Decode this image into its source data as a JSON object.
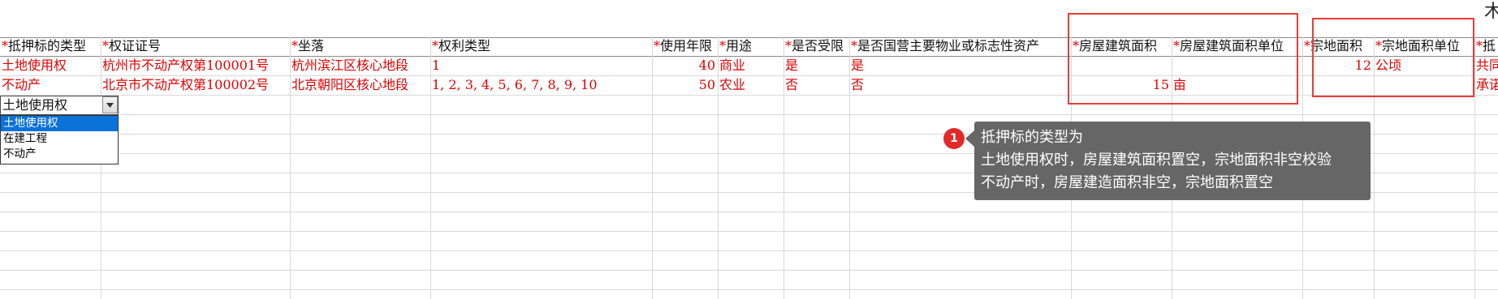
{
  "corner_glyph": "木",
  "headers": [
    {
      "label": "抵押标的类型",
      "star": "*"
    },
    {
      "label": "权证证号",
      "star": "*"
    },
    {
      "label": "坐落",
      "star": "*"
    },
    {
      "label": "权利类型",
      "star": "*"
    },
    {
      "label": "使用年限",
      "star": "*"
    },
    {
      "label": "用途",
      "star": "*"
    },
    {
      "label": "是否受限",
      "star": "*"
    },
    {
      "label": "是否国营主要物业或标志性资产",
      "star": "*"
    },
    {
      "label": "房屋建筑面积",
      "star": "*"
    },
    {
      "label": "房屋建筑面积单位",
      "star": "*"
    },
    {
      "label": "宗地面积",
      "star": "*"
    },
    {
      "label": "宗地面积单位",
      "star": "*"
    },
    {
      "label": "抵",
      "star": "*"
    }
  ],
  "rows": [
    {
      "type": "土地使用权",
      "cert": "杭州市不动产权第100001号",
      "location": "杭州滨江区核心地段",
      "right_type": "1",
      "years": "40",
      "usage": "商业",
      "restricted": "是",
      "state_owned": "是",
      "building_area": "",
      "building_unit": "",
      "land_area": "12",
      "land_unit": "公顷",
      "extra": "共同"
    },
    {
      "type": "不动产",
      "cert": "北京市不动产权第100002号",
      "location": "北京朝阳区核心地段",
      "right_type": "1, 2, 3, 4, 5, 6, 7, 8, 9, 10",
      "years": "50",
      "usage": "农业",
      "restricted": "否",
      "state_owned": "否",
      "building_area": "15",
      "building_unit": "亩",
      "land_area": "",
      "land_unit": "",
      "extra": "承诺"
    }
  ],
  "dropdown": {
    "value": "土地使用权",
    "options": [
      "土地使用权",
      "在建工程",
      "不动产"
    ],
    "selected_index": 0
  },
  "tooltip": {
    "badge": "1",
    "lines": [
      "抵押标的类型为",
      "土地使用权时，房屋建筑面积置空，宗地面积非空校验",
      "不动产时，房屋建造面积非空，宗地面积置空"
    ]
  },
  "colors": {
    "required_red": "#e00000",
    "highlight_border": "#ea3b3b",
    "tooltip_bg": "#666666",
    "selection_blue": "#0a72d9"
  }
}
